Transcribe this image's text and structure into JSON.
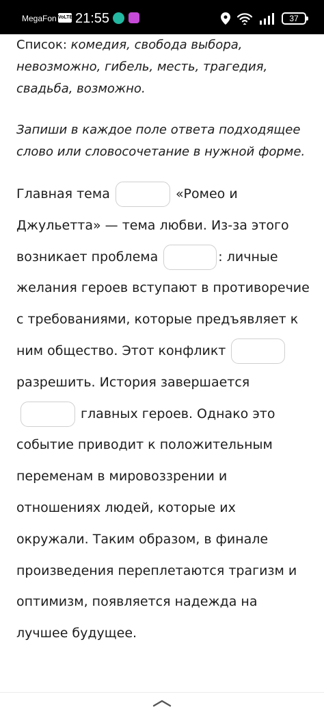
{
  "status_bar": {
    "carrier": "MegaFon",
    "volte": "VoLTE",
    "time": "21:55",
    "battery": "37"
  },
  "list": {
    "label": "Список: ",
    "items": "комедия, свобода выбора, невозможно, гибель, месть, трагедия, свадьба, возможно."
  },
  "instruction": "Запиши в каждое поле ответа подходящее слово или словосочетание в нужной форме.",
  "passage": {
    "seg1": "Главная тема",
    "seg2": "«Ромео и Джульетта» — тема любви. Из-за этого возникает проблема",
    "seg3": ": личные желания героев вступают в противоречие с требованиями, которые предъявляет к ним общество. Этот конфликт",
    "seg4": "разрешить. История завершается",
    "seg5": "главных героев. Однако это событие приводит к положительным переменам в мировоззрении и отношениях людей, которые их окружали. Таким образом, в финале произведения переплетаются трагизм и оптимизм, появляется надежда на лучшее будущее."
  }
}
